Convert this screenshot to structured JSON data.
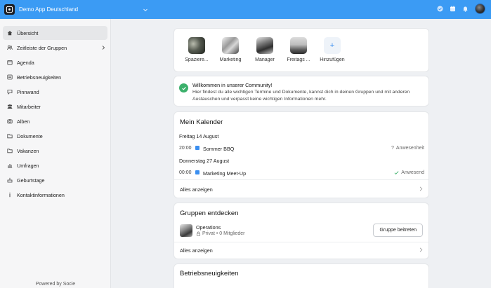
{
  "header": {
    "app_name": "Demo App Deutschland",
    "icons": [
      "tasks-check-icon",
      "calendar-icon",
      "bell-icon"
    ],
    "accent_color": "#3b9bf4"
  },
  "sidebar": {
    "items": [
      {
        "label": "Übersicht",
        "icon": "home-icon",
        "active": true
      },
      {
        "label": "Zeitleiste der Gruppen",
        "icon": "groups-icon",
        "has_submenu": true
      },
      {
        "label": "Agenda",
        "icon": "calendar-icon"
      },
      {
        "label": "Betriebsneuigkeiten",
        "icon": "news-icon"
      },
      {
        "label": "Pinnwand",
        "icon": "chat-icon"
      },
      {
        "label": "Mitarbeiter",
        "icon": "people-icon"
      },
      {
        "label": "Alben",
        "icon": "camera-icon"
      },
      {
        "label": "Dokumente",
        "icon": "folder-icon"
      },
      {
        "label": "Vakanzen",
        "icon": "folder-icon"
      },
      {
        "label": "Umfragen",
        "icon": "chart-icon"
      },
      {
        "label": "Geburtstage",
        "icon": "cake-icon"
      },
      {
        "label": "Kontaktinformationen",
        "icon": "info-icon"
      }
    ],
    "footer": "Powered by Socie"
  },
  "shortcuts": [
    {
      "label": "Spaziere..."
    },
    {
      "label": "Marketing"
    },
    {
      "label": "Manager"
    },
    {
      "label": "Freitags ..."
    },
    {
      "label": "Hinzufügen"
    }
  ],
  "welcome": {
    "title": "Willkommen in unserer Community!",
    "text": "Hier findest du alle wichtigen Termine und Dokumente, kannst dich in deinen Gruppen und mit anderen Austauschen und verpasst keine wichtigen Informationen mehr."
  },
  "calendar": {
    "title": "Mein Kalender",
    "days": [
      {
        "date": "Freitag 14 August",
        "time": "20:00",
        "event": "Sommer BBQ",
        "status": "Anwesenheit",
        "status_icon": "question-icon"
      },
      {
        "date": "Donnerstag 27 August",
        "time": "00:00",
        "event": "Marketing Meet-Up",
        "status": "Anwesend",
        "status_icon": "check-icon"
      }
    ],
    "show_all": "Alles anzeigen"
  },
  "groups": {
    "title": "Gruppen entdecken",
    "item": {
      "name": "Operations",
      "privacy": "Privat",
      "members": "• 0 Mitglieder"
    },
    "join_label": "Gruppe beitreten",
    "show_all": "Alles anzeigen"
  },
  "news": {
    "title": "Betriebsneuigkeiten"
  }
}
